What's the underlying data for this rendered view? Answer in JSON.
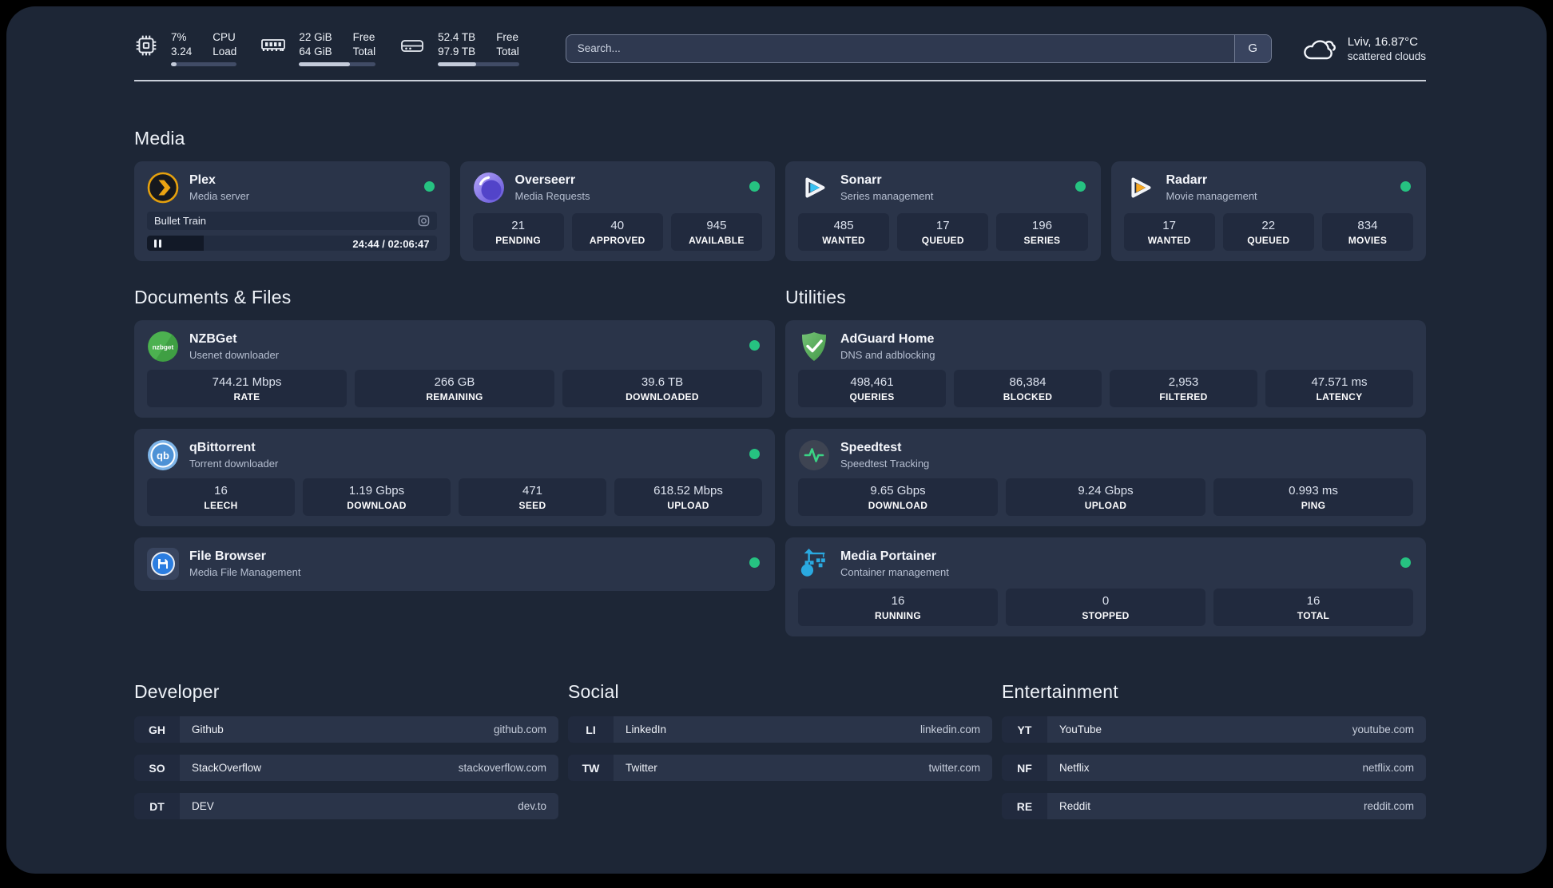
{
  "topbar": {
    "cpu": {
      "value_top": "7%",
      "value_bottom": "3.24",
      "label_top": "CPU",
      "label_bottom": "Load",
      "progress_pct": 8
    },
    "memory": {
      "value_top": "22 GiB",
      "value_bottom": "64 GiB",
      "label_top": "Free",
      "label_bottom": "Total",
      "progress_pct": 66
    },
    "disk": {
      "value_top": "52.4 TB",
      "value_bottom": "97.9 TB",
      "label_top": "Free",
      "label_bottom": "Total",
      "progress_pct": 47
    },
    "search": {
      "placeholder": "Search...",
      "engine_button": "G"
    },
    "weather": {
      "location_temp": "Lviv, 16.87°C",
      "condition": "scattered clouds"
    }
  },
  "sections": {
    "media": "Media",
    "documents": "Documents & Files",
    "utilities": "Utilities",
    "developer": "Developer",
    "social": "Social",
    "entertainment": "Entertainment"
  },
  "apps": {
    "plex": {
      "name": "Plex",
      "subtitle": "Media server",
      "now_playing": "Bullet Train",
      "time": "24:44 / 02:06:47",
      "progress_pct": 19.5
    },
    "overseerr": {
      "name": "Overseerr",
      "subtitle": "Media Requests",
      "stats": [
        {
          "value": "21",
          "label": "PENDING"
        },
        {
          "value": "40",
          "label": "APPROVED"
        },
        {
          "value": "945",
          "label": "AVAILABLE"
        }
      ]
    },
    "sonarr": {
      "name": "Sonarr",
      "subtitle": "Series management",
      "stats": [
        {
          "value": "485",
          "label": "WANTED"
        },
        {
          "value": "17",
          "label": "QUEUED"
        },
        {
          "value": "196",
          "label": "SERIES"
        }
      ]
    },
    "radarr": {
      "name": "Radarr",
      "subtitle": "Movie management",
      "stats": [
        {
          "value": "17",
          "label": "WANTED"
        },
        {
          "value": "22",
          "label": "QUEUED"
        },
        {
          "value": "834",
          "label": "MOVIES"
        }
      ]
    },
    "nzbget": {
      "name": "NZBGet",
      "subtitle": "Usenet downloader",
      "icon_text": "nzbget",
      "stats": [
        {
          "value": "744.21 Mbps",
          "label": "RATE"
        },
        {
          "value": "266 GB",
          "label": "REMAINING"
        },
        {
          "value": "39.6 TB",
          "label": "DOWNLOADED"
        }
      ]
    },
    "qbittorrent": {
      "name": "qBittorrent",
      "subtitle": "Torrent downloader",
      "icon_text": "qb",
      "stats": [
        {
          "value": "16",
          "label": "LEECH"
        },
        {
          "value": "1.19 Gbps",
          "label": "DOWNLOAD"
        },
        {
          "value": "471",
          "label": "SEED"
        },
        {
          "value": "618.52 Mbps",
          "label": "UPLOAD"
        }
      ]
    },
    "filebrowser": {
      "name": "File Browser",
      "subtitle": "Media File Management"
    },
    "adguard": {
      "name": "AdGuard Home",
      "subtitle": "DNS and adblocking",
      "stats": [
        {
          "value": "498,461",
          "label": "QUERIES"
        },
        {
          "value": "86,384",
          "label": "BLOCKED"
        },
        {
          "value": "2,953",
          "label": "FILTERED"
        },
        {
          "value": "47.571 ms",
          "label": "LATENCY"
        }
      ]
    },
    "speedtest": {
      "name": "Speedtest",
      "subtitle": "Speedtest Tracking",
      "stats": [
        {
          "value": "9.65 Gbps",
          "label": "DOWNLOAD"
        },
        {
          "value": "9.24 Gbps",
          "label": "UPLOAD"
        },
        {
          "value": "0.993 ms",
          "label": "PING"
        }
      ]
    },
    "portainer": {
      "name": "Media Portainer",
      "subtitle": "Container management",
      "stats": [
        {
          "value": "16",
          "label": "RUNNING"
        },
        {
          "value": "0",
          "label": "STOPPED"
        },
        {
          "value": "16",
          "label": "TOTAL"
        }
      ]
    }
  },
  "bookmarks": {
    "developer": [
      {
        "abbr": "GH",
        "name": "Github",
        "url": "github.com"
      },
      {
        "abbr": "SO",
        "name": "StackOverflow",
        "url": "stackoverflow.com"
      },
      {
        "abbr": "DT",
        "name": "DEV",
        "url": "dev.to"
      }
    ],
    "social": [
      {
        "abbr": "LI",
        "name": "LinkedIn",
        "url": "linkedin.com"
      },
      {
        "abbr": "TW",
        "name": "Twitter",
        "url": "twitter.com"
      }
    ],
    "entertainment": [
      {
        "abbr": "YT",
        "name": "YouTube",
        "url": "youtube.com"
      },
      {
        "abbr": "NF",
        "name": "Netflix",
        "url": "netflix.com"
      },
      {
        "abbr": "RE",
        "name": "Reddit",
        "url": "reddit.com"
      }
    ]
  },
  "colors": {
    "status_online": "#26c281",
    "accent_green": "#3bd385"
  }
}
